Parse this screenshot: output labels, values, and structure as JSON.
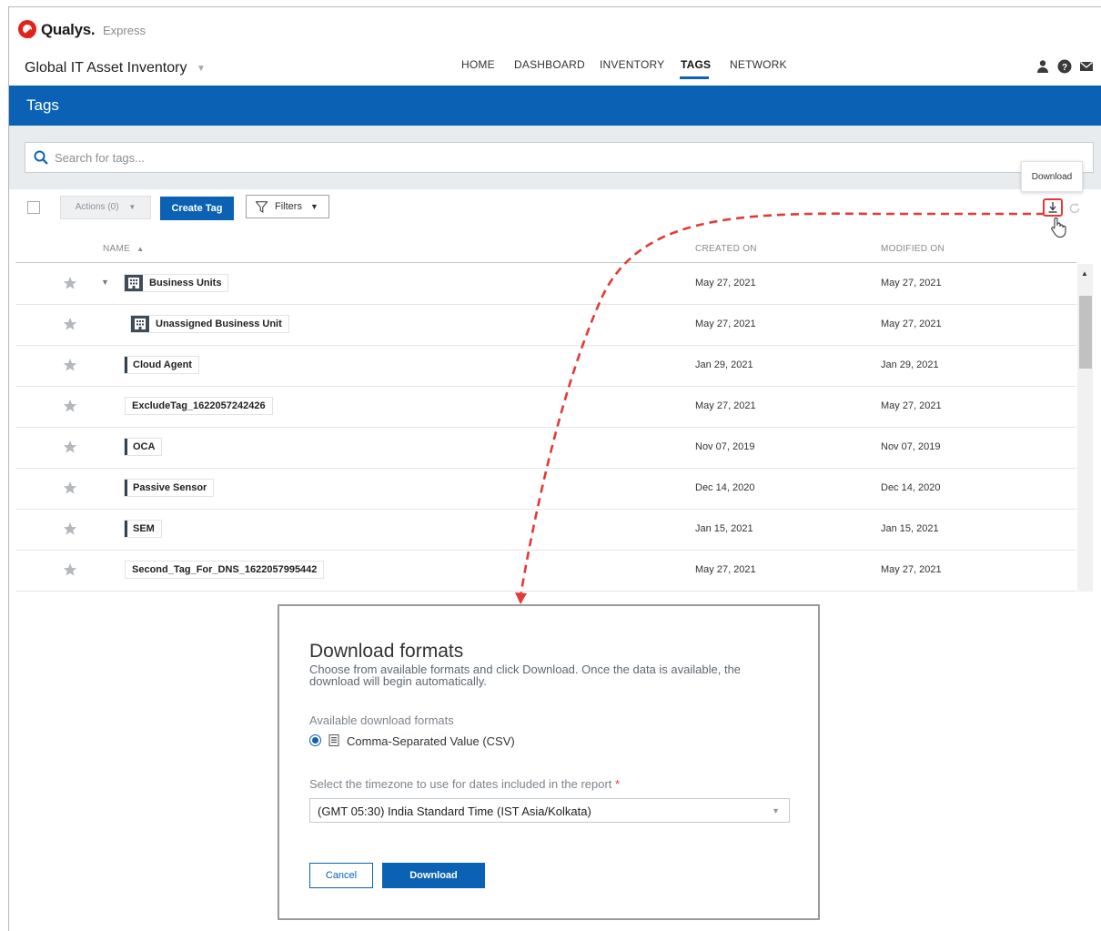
{
  "brand": {
    "name": "Qualys.",
    "product": "Express"
  },
  "app": {
    "title": "Global IT Asset Inventory"
  },
  "nav": {
    "items": [
      {
        "label": "HOME"
      },
      {
        "label": "DASHBOARD"
      },
      {
        "label": "INVENTORY"
      },
      {
        "label": "TAGS",
        "active": true
      },
      {
        "label": "NETWORK"
      }
    ]
  },
  "top_icons": [
    "user-icon",
    "help-icon",
    "mail-icon"
  ],
  "page": {
    "title": "Tags"
  },
  "search": {
    "placeholder": "Search for tags...",
    "value": ""
  },
  "toolbar": {
    "actions_label": "Actions (0)",
    "create_label": "Create Tag",
    "filters_label": "Filters",
    "download_tooltip": "Download"
  },
  "table": {
    "columns": {
      "name": "NAME",
      "created": "CREATED ON",
      "modified": "MODIFIED ON"
    },
    "sort": {
      "column": "NAME",
      "direction": "ascending"
    },
    "rows": [
      {
        "name": "Business Units",
        "icon": "building-icon",
        "expandable": true,
        "created": "May 27, 2021",
        "modified": "May 27, 2021"
      },
      {
        "name": "Unassigned Business Unit",
        "icon": "building-icon",
        "created": "May 27, 2021",
        "modified": "May 27, 2021"
      },
      {
        "name": "Cloud Agent",
        "icon": "bar",
        "created": "Jan 29, 2021",
        "modified": "Jan 29, 2021"
      },
      {
        "name": "ExcludeTag_1622057242426",
        "icon": "none",
        "created": "May 27, 2021",
        "modified": "May 27, 2021"
      },
      {
        "name": "OCA",
        "icon": "bar",
        "created": "Nov 07, 2019",
        "modified": "Nov 07, 2019"
      },
      {
        "name": "Passive Sensor",
        "icon": "bar",
        "created": "Dec 14, 2020",
        "modified": "Dec 14, 2020"
      },
      {
        "name": "SEM",
        "icon": "bar",
        "created": "Jan 15, 2021",
        "modified": "Jan 15, 2021"
      },
      {
        "name": "Second_Tag_For_DNS_1622057995442",
        "icon": "none",
        "created": "May 27, 2021",
        "modified": "May 27, 2021"
      }
    ]
  },
  "dialog": {
    "title": "Download formats",
    "description": "Choose from available formats and click Download. Once the data is available, the download will begin automatically.",
    "formats_label": "Available download formats",
    "format_option": "Comma-Separated Value (CSV)",
    "timezone_label": "Select the timezone to use for dates included in the report",
    "timezone_required": "*",
    "timezone_value": "(GMT 05:30) India Standard Time (IST Asia/Kolkata)",
    "cancel_label": "Cancel",
    "download_label": "Download"
  },
  "colors": {
    "primary": "#0b62b4",
    "brand_red": "#e2231a",
    "annotation_red": "#e53935"
  }
}
